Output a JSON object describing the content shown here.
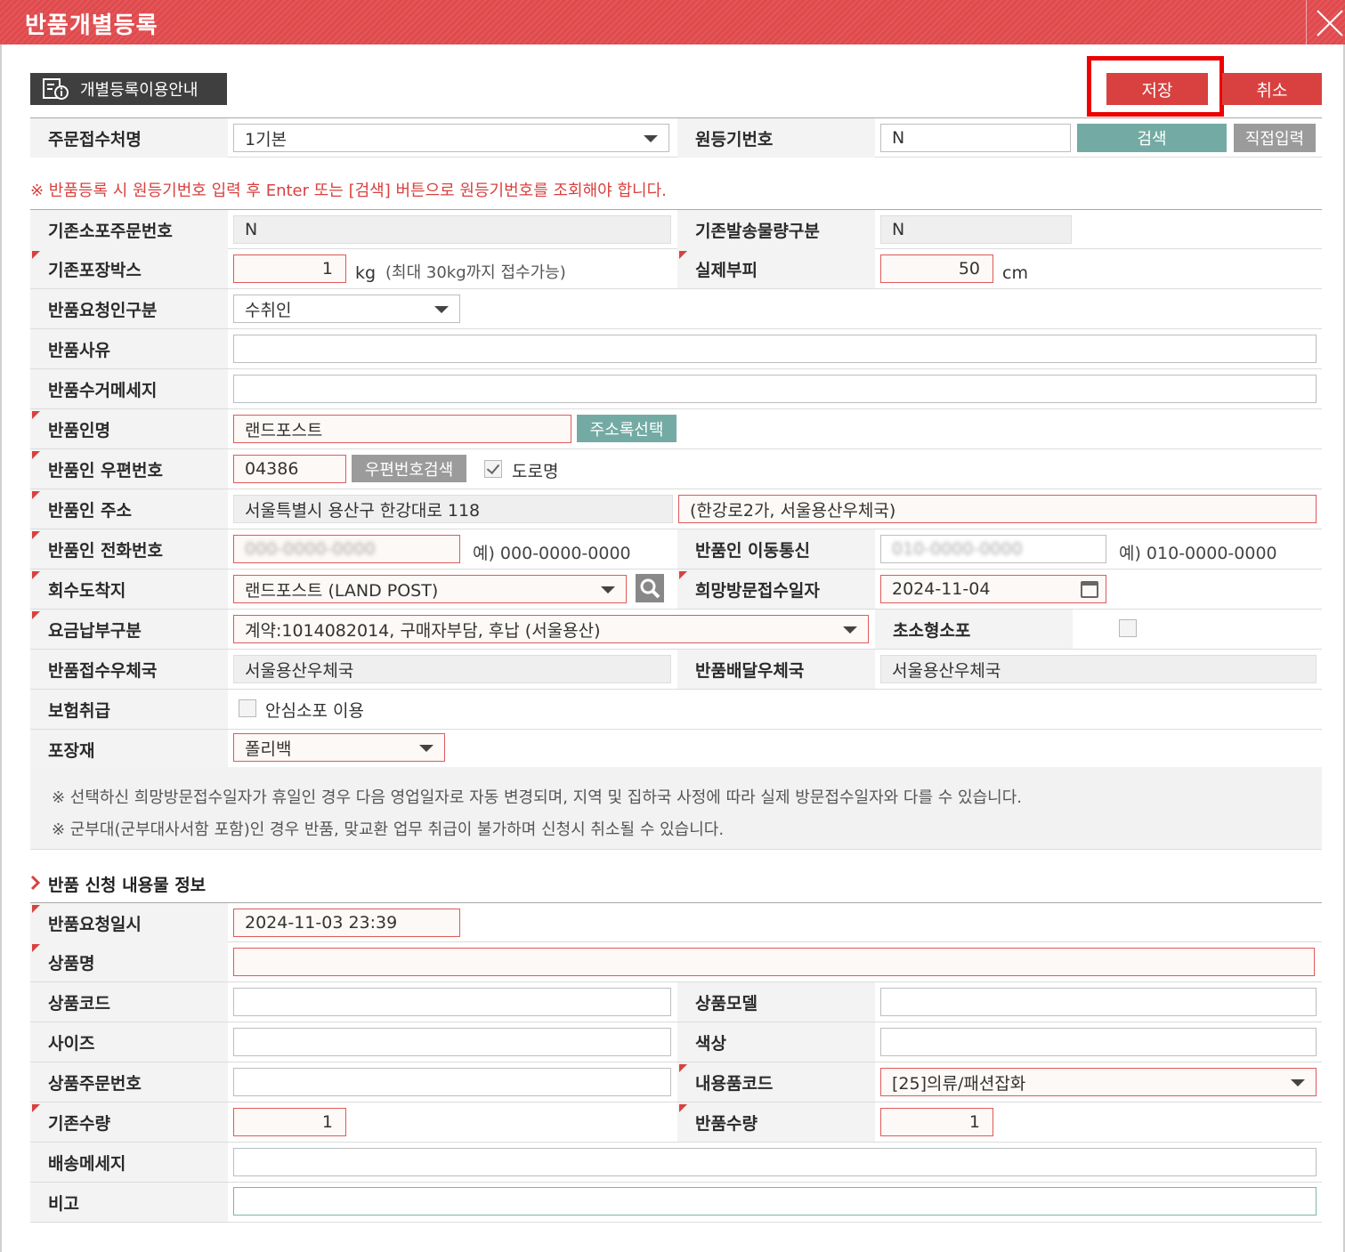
{
  "window": {
    "title": "반품개별등록"
  },
  "toolbar": {
    "guide_label": "개별등록이용안내",
    "save_label": "저장",
    "cancel_label": "취소"
  },
  "header_row": {
    "order_office_label": "주문접수처명",
    "order_office_value": "1기본",
    "reg_no_label": "원등기번호",
    "reg_no_value": "N",
    "search_label": "검색",
    "direct_input_label": "직접입력"
  },
  "notice": "※ 반품등록 시 원등기번호 입력 후 Enter 또는 [검색] 버튼으로 원등기번호를 조회해야 합니다.",
  "form": {
    "orig_order_no_label": "기존소포주문번호",
    "orig_order_no_value": "N",
    "orig_weight_class_label": "기존발송물량구분",
    "orig_weight_class_value": "N",
    "orig_box_label": "기존포장박스",
    "orig_box_value": "1",
    "orig_box_unit": "kg",
    "orig_box_hint": "(최대 30kg까지 접수가능)",
    "volume_label": "실제부피",
    "volume_value": "50",
    "volume_unit": "cm",
    "requester_type_label": "반품요청인구분",
    "requester_type_value": "수취인",
    "reason_label": "반품사유",
    "reason_value": "",
    "pickup_msg_label": "반품수거메세지",
    "pickup_msg_value": "",
    "sender_name_label": "반품인명",
    "sender_name_value": "랜드포스트",
    "address_book_label": "주소록선택",
    "zip_label": "반품인 우편번호",
    "zip_value": "04386",
    "zip_search_label": "우편번호검색",
    "road_name_label": "도로명",
    "address_label": "반품인 주소",
    "address_value": "서울특별시 용산구 한강대로 118",
    "address_detail_value": "(한강로2가, 서울용산우체국)",
    "phone_label": "반품인 전화번호",
    "phone_value": "000-0000-0000",
    "phone_hint": "예) 000-0000-0000",
    "mobile_label": "반품인 이동통신",
    "mobile_value": "010-0000-0000",
    "mobile_hint": "예) 010-0000-0000",
    "destination_label": "회수도착지",
    "destination_value": "랜드포스트 (LAND POST)",
    "visit_date_label": "희망방문접수일자",
    "visit_date_value": "2024-11-04",
    "payment_label": "요금납부구분",
    "payment_value": "계약:1014082014, 구매자부담, 후납 (서울용산)",
    "small_parcel_label": "초소형소포",
    "receive_office_label": "반품접수우체국",
    "receive_office_value": "서울용산우체국",
    "delivery_office_label": "반품배달우체국",
    "delivery_office_value": "서울용산우체국",
    "insurance_label": "보험취급",
    "insurance_option": "안심소포 이용",
    "packaging_label": "포장재",
    "packaging_value": "폴리백"
  },
  "info_lines": [
    "※ 선택하신 희망방문접수일자가 휴일인 경우 다음 영업일자로 자동  변경되며, 지역 및 집하국 사정에 따라 실제 방문접수일자와 다를 수 있습니다.",
    "※ 군부대(군부대사서함 포함)인 경우 반품, 맞교환 업무 취급이 불가하며 신청시 취소될 수 있습니다."
  ],
  "contents": {
    "section_title": "반품 신청 내용물 정보",
    "request_date_label": "반품요청일시",
    "request_date_value": "2024-11-03 23:39",
    "product_name_label": "상품명",
    "product_name_value": "",
    "product_code_label": "상품코드",
    "product_code_value": "",
    "product_model_label": "상품모델",
    "product_model_value": "",
    "size_label": "사이즈",
    "size_value": "",
    "color_label": "색상",
    "color_value": "",
    "product_order_no_label": "상품주문번호",
    "product_order_no_value": "",
    "content_code_label": "내용품코드",
    "content_code_value": "[25]의류/패션잡화",
    "orig_qty_label": "기존수량",
    "orig_qty_value": "1",
    "return_qty_label": "반품수량",
    "return_qty_value": "1",
    "delivery_msg_label": "배송메세지",
    "delivery_msg_value": "",
    "note_label": "비고",
    "note_value": ""
  },
  "colors": {
    "accent": "#d8413f",
    "teal": "#73aba4",
    "highlight": "#ec0000"
  }
}
